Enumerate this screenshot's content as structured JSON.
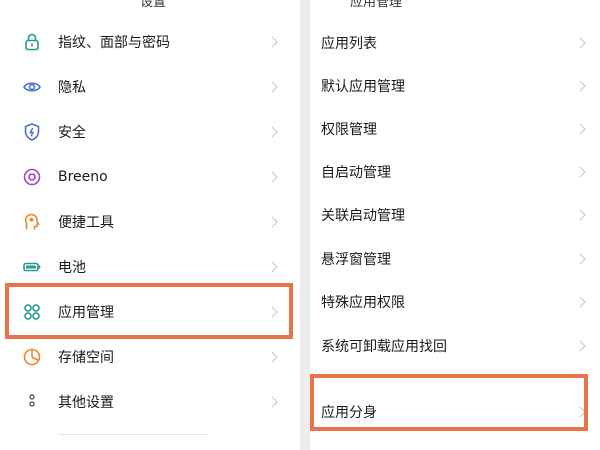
{
  "left": {
    "top_fragment": "设置",
    "items": [
      {
        "label": "指纹、面部与密码",
        "icon": "lock-icon"
      },
      {
        "label": "隐私",
        "icon": "eye-icon"
      },
      {
        "label": "安全",
        "icon": "shield-icon"
      },
      {
        "label": "Breeno",
        "icon": "breeno-icon"
      },
      {
        "label": "便捷工具",
        "icon": "tools-icon"
      },
      {
        "label": "电池",
        "icon": "battery-icon"
      },
      {
        "label": "应用管理",
        "icon": "apps-icon"
      },
      {
        "label": "存储空间",
        "icon": "storage-icon"
      },
      {
        "label": "其他设置",
        "icon": "more-icon"
      }
    ]
  },
  "right": {
    "top_fragment": "应用管理",
    "items": [
      {
        "label": "应用列表"
      },
      {
        "label": "默认应用管理"
      },
      {
        "label": "权限管理"
      },
      {
        "label": "自启动管理"
      },
      {
        "label": "关联启动管理"
      },
      {
        "label": "悬浮窗管理"
      },
      {
        "label": "特殊应用权限"
      },
      {
        "label": "系统可卸载应用找回"
      },
      {
        "label": "应用分身"
      }
    ]
  },
  "colors": {
    "highlight": "#e9744a",
    "icon_teal": "#2a9a8a",
    "icon_blue": "#4a6fd0",
    "icon_purple": "#a246c8",
    "icon_orange": "#f0882a",
    "icon_pink": "#e0508a"
  }
}
